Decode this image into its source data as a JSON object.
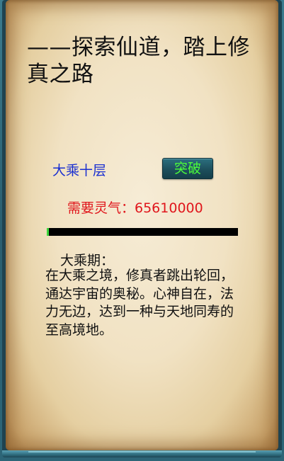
{
  "title": "——探索仙道，踏上修真之路",
  "realm": {
    "name": "大乘十层",
    "breakthrough_label": "突破",
    "requirement_text": "需要灵气：65610000",
    "progress": 0.01
  },
  "description": {
    "heading": "大乘期：",
    "body": "在大乘之境，修真者跳出轮回，通达宇宙的奥秘。心神自在，法力无边，达到一种与天地同寿的至高境地。"
  },
  "colors": {
    "frame": "#2d6577",
    "realm_name": "#1a2fd0",
    "button_text": "#4cff3a",
    "requirement": "#e0161c",
    "progress_track": "#000000",
    "progress_fill": "#3cd43c"
  }
}
